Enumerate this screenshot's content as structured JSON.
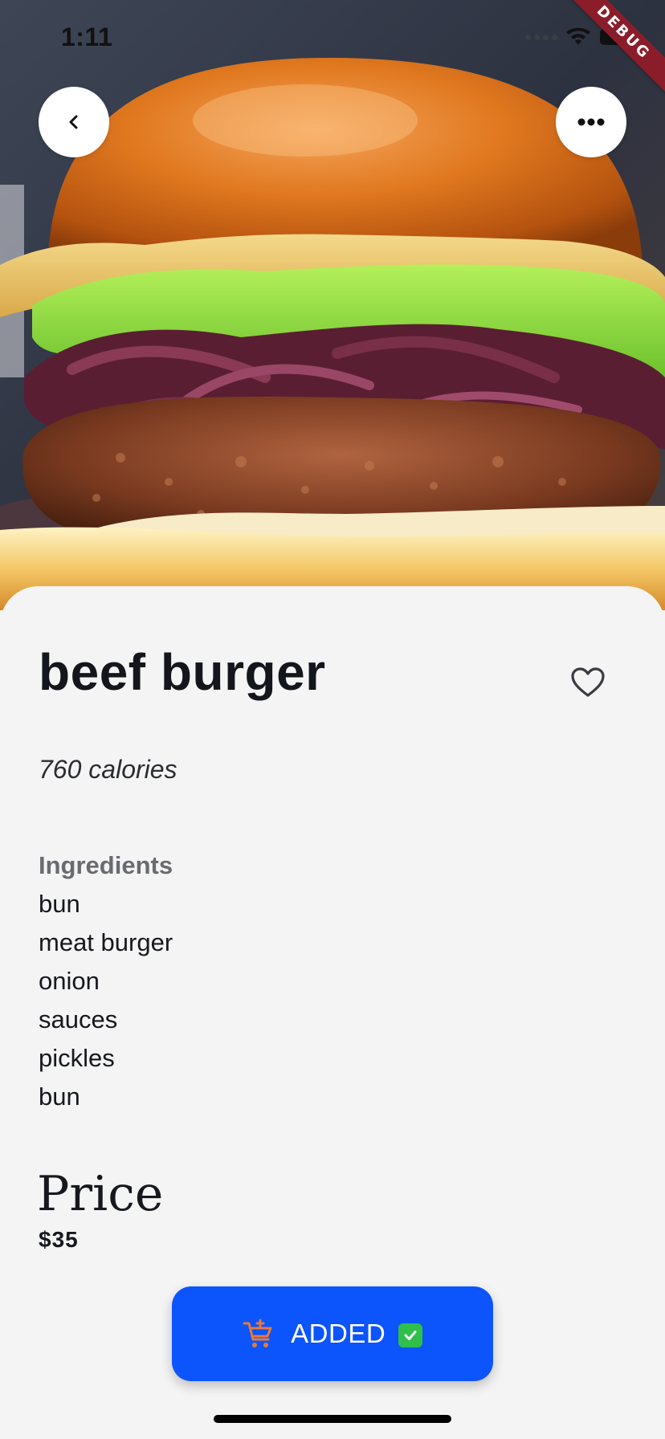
{
  "status_bar": {
    "time": "1:11",
    "debug_banner": "DEBUG"
  },
  "hero": {
    "image_icon": "burger-photo"
  },
  "nav": {
    "back_icon": "chevron-left-icon",
    "more_icon": "more-horizontal-icon"
  },
  "product": {
    "name": "beef burger",
    "calories": "760 calories",
    "favorite_icon": "heart-outline-icon",
    "ingredients_heading": "Ingredients",
    "ingredients": [
      "bun",
      "meat burger",
      "onion",
      "sauces",
      "pickles",
      "bun"
    ],
    "price_label": "Price",
    "price": "$35"
  },
  "cart_button": {
    "label": "ADDED",
    "icon": "cart-add-icon",
    "status_icon": "check-mark-icon"
  },
  "colors": {
    "accent": "#0c54fb",
    "cart_icon": "#e8793a",
    "check": "#2fbf4a",
    "background": "#f4f4f5"
  }
}
